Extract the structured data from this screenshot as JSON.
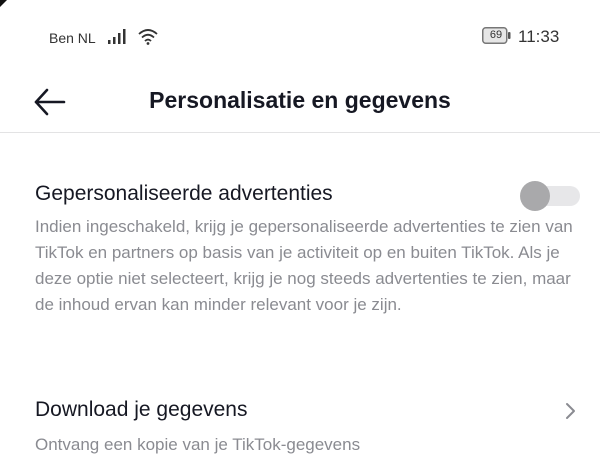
{
  "status_bar": {
    "carrier": "Ben NL",
    "signal_icon": "cellular-signal-icon",
    "wifi_icon": "wifi-icon",
    "battery_icon": "battery-icon",
    "battery_level": "69",
    "time": "11:33"
  },
  "header": {
    "back_icon": "arrow-left-icon",
    "title": "Personalisatie en gegevens"
  },
  "settings": {
    "personalized_ads": {
      "title": "Gepersonaliseerde advertenties",
      "description": "Indien ingeschakeld, krijg je gepersonaliseerde advertenties te zien van TikTok en partners op basis van je activiteit op en buiten TikTok. Als je deze optie niet selecteert, krijg je nog steeds advertenties te zien, maar de inhoud ervan kan minder relevant voor je zijn.",
      "enabled": false
    },
    "download_data": {
      "title": "Download je gegevens",
      "description": "Ontvang een kopie van je TikTok-gegevens",
      "icon": "chevron-right-icon"
    }
  },
  "colors": {
    "text_primary": "#161823",
    "text_secondary": "#8a8b91",
    "toggle_track": "#e7e7e9",
    "toggle_knob": "#a9a9ab",
    "divider": "#e3e3e4"
  }
}
